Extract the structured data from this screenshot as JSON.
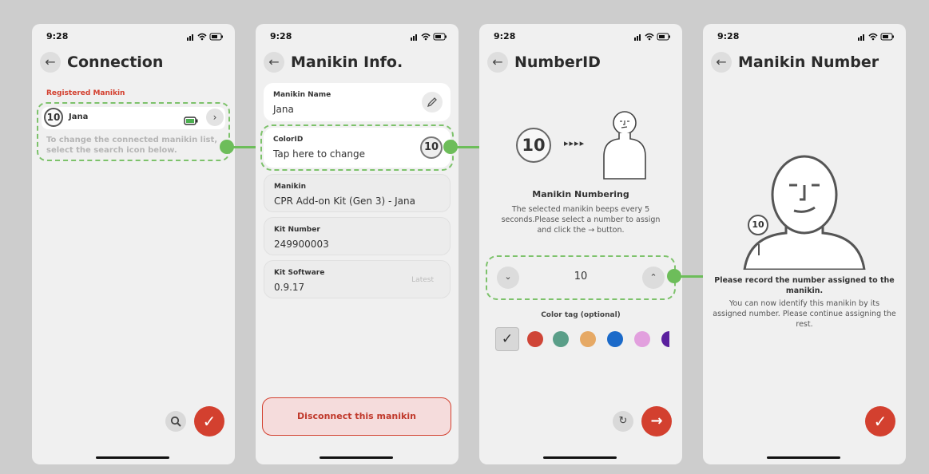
{
  "status": {
    "time": "9:28"
  },
  "screens": {
    "connection": {
      "title": "Connection",
      "section_label": "Registered Manikin",
      "manikin_number": "10",
      "manikin_name": "Jana",
      "hint_line1": "To change the connected manikin list,",
      "hint_line2": "select the search icon below."
    },
    "manikin_info": {
      "title": "Manikin Info.",
      "name_label": "Manikin Name",
      "name_value": "Jana",
      "colorid_label": "ColorID",
      "colorid_value": "Tap here to change",
      "colorid_number": "10",
      "manikin_label": "Manikin",
      "manikin_value": "CPR Add-on Kit (Gen 3) - Jana",
      "kit_number_label": "Kit Number",
      "kit_number_value": "249900003",
      "kit_software_label": "Kit Software",
      "kit_software_value": "0.9.17",
      "kit_software_status": "Latest",
      "disconnect_label": "Disconnect this manikin"
    },
    "number_id": {
      "title": "NumberID",
      "number": "10",
      "beeps": "▸▸▸▸",
      "heading": "Manikin Numbering",
      "desc_line1": "The selected manikin beeps every 5",
      "desc_line2": "seconds.Please select a number to assign",
      "desc_line3": "and click the → button.",
      "stepper_value": "10",
      "color_tag_label": "Color tag (optional)"
    },
    "manikin_number": {
      "title": "Manikin Number",
      "badge_number": "10",
      "bold_line1": "Please record the number assigned to the",
      "bold_line2": "manikin.",
      "text_line1": "You can now identify this manikin by its",
      "text_line2": "assigned number. Please continue assigning the",
      "text_line3": "rest."
    }
  },
  "colors": {
    "accent_red": "#d3402f",
    "flow_green": "#6dbd5a",
    "swatches": [
      "#cf4537",
      "#5a9e88",
      "#e6a965",
      "#1b6ac9",
      "#e2a0de",
      "#5a1f9e"
    ]
  }
}
